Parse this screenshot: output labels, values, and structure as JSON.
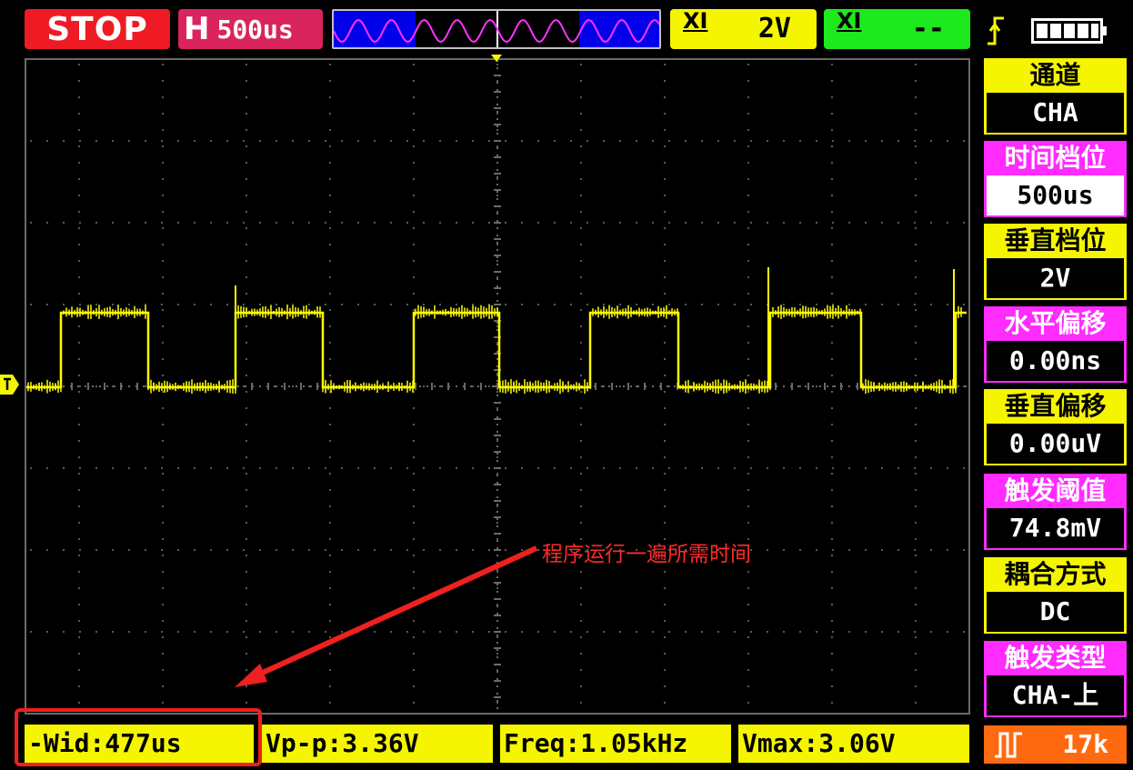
{
  "topbar": {
    "run_state": "STOP",
    "timebase_prefix": "H",
    "timebase_value": "500us",
    "channel_scale_label": "XI",
    "channel_scale_value": "2V",
    "trigger_label": "XI",
    "trigger_value": "--",
    "trigger_edge_icon": "rising-edge-icon",
    "battery_icon": "battery-full-icon"
  },
  "colors": {
    "trace": "#ffff00",
    "stop": "#ee1b24",
    "menu_yellow": "#f5f500",
    "menu_magenta": "#ff2bff",
    "annotation": "#ff2a2a"
  },
  "screen": {
    "annotation_text": "程序运行一遍所需时间"
  },
  "menu": [
    {
      "label": "通道",
      "value": "CHA",
      "style": "yellow",
      "selected": false
    },
    {
      "label": "时间档位",
      "value": "500us",
      "style": "magenta",
      "selected": true
    },
    {
      "label": "垂直档位",
      "value": "2V",
      "style": "yellow",
      "selected": false
    },
    {
      "label": "水平偏移",
      "value": "0.00ns",
      "style": "magenta",
      "selected": false
    },
    {
      "label": "垂直偏移",
      "value": "0.00uV",
      "style": "yellow",
      "selected": false
    },
    {
      "label": "触发阈值",
      "value": "74.8mV",
      "style": "magenta",
      "selected": false
    },
    {
      "label": "耦合方式",
      "value": "DC",
      "style": "yellow",
      "selected": false
    },
    {
      "label": "触发类型",
      "value": "CHA-上",
      "style": "magenta",
      "selected": false
    }
  ],
  "menu_extra": {
    "icon": "pulse-icon",
    "value": "17k"
  },
  "measurements": [
    {
      "text": "-Wid:477us"
    },
    {
      "text": "Vp-p:3.36V"
    },
    {
      "text": "Freq:1.05kHz"
    },
    {
      "text": "Vmax:3.06V"
    }
  ]
}
